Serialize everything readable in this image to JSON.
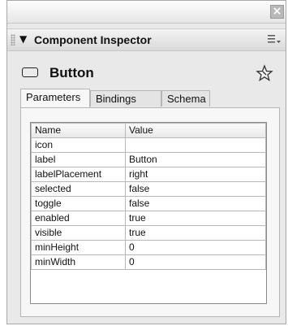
{
  "panel": {
    "title": "Component Inspector",
    "close_glyph": "×",
    "collapse_glyph": "▼"
  },
  "component": {
    "name": "Button"
  },
  "tabs": [
    "Parameters",
    "Bindings",
    "Schema"
  ],
  "grid": {
    "headers": [
      "Name",
      "Value"
    ],
    "rows": [
      {
        "name": "icon",
        "value": ""
      },
      {
        "name": "label",
        "value": "Button"
      },
      {
        "name": "labelPlacement",
        "value": "right"
      },
      {
        "name": "selected",
        "value": "false"
      },
      {
        "name": "toggle",
        "value": "false"
      },
      {
        "name": "enabled",
        "value": "true"
      },
      {
        "name": "visible",
        "value": "true"
      },
      {
        "name": "minHeight",
        "value": "0"
      },
      {
        "name": "minWidth",
        "value": "0"
      }
    ]
  }
}
